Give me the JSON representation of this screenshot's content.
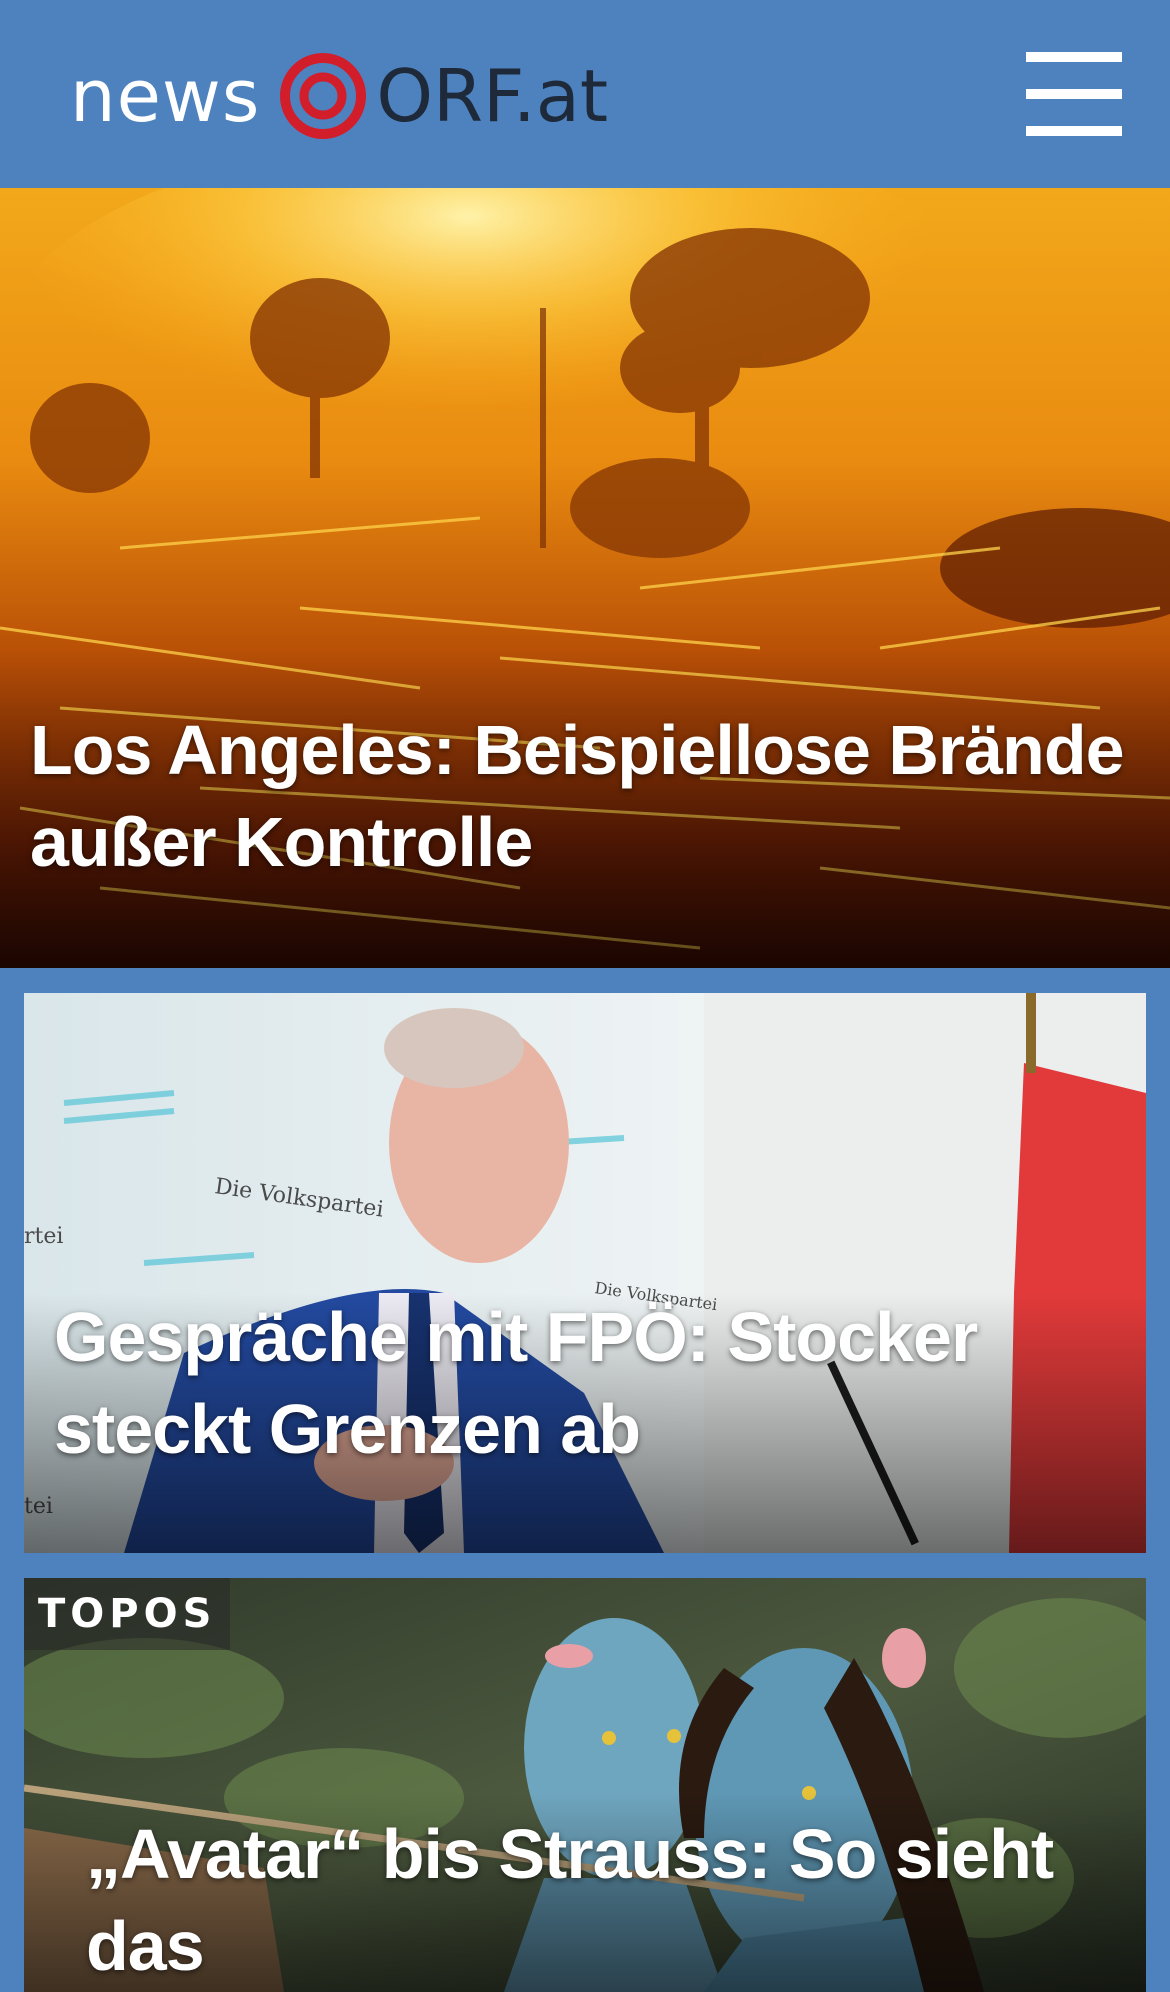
{
  "header": {
    "logo_news": "news",
    "logo_orf": "ORF.at",
    "menu_icon": "hamburger-menu-icon"
  },
  "colors": {
    "brand_blue": "#4d82bf",
    "logo_red": "#d21e2b",
    "logo_dark": "#1e2a3a"
  },
  "stories": [
    {
      "headline": "Los Angeles: Beispiellose Brände außer Kontrolle",
      "tag": ""
    },
    {
      "headline": "Gespräche mit FPÖ: Stocker steckt Grenzen ab",
      "tag": ""
    },
    {
      "headline": "„Avatar“ bis Strauss: So sieht das",
      "tag": "TOPOS"
    }
  ],
  "image_text": {
    "banner_1": "Die Volkspartei",
    "banner_2": "Die Volkspartei",
    "banner_3": "rtei",
    "banner_4": "tei"
  }
}
